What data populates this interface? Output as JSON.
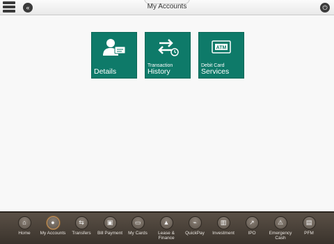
{
  "header": {
    "title": "My Accounts",
    "back_icon": "«",
    "power_icon": "⏻"
  },
  "tiles": [
    {
      "small": "",
      "big": "Details",
      "icon": "user-card-icon"
    },
    {
      "small": "Transaction",
      "big": "History",
      "icon": "transfer-clock-icon"
    },
    {
      "small": "Debit Card",
      "big": "Services",
      "icon": "atm-card-icon",
      "icon_text": "ATM"
    }
  ],
  "nav": [
    {
      "label": "Home",
      "glyph": "⌂"
    },
    {
      "label": "My Accounts",
      "glyph": "●"
    },
    {
      "label": "Transfers",
      "glyph": "⇆"
    },
    {
      "label": "Bill Payment",
      "glyph": "▣"
    },
    {
      "label": "My Cards",
      "glyph": "▭"
    },
    {
      "label": "Lease &\nFinance",
      "glyph": "▲"
    },
    {
      "label": "QuickPay",
      "glyph": "⌁"
    },
    {
      "label": "Investment",
      "glyph": "▥"
    },
    {
      "label": "IPO",
      "glyph": "↗"
    },
    {
      "label": "Emergency\nCash",
      "glyph": "⚠"
    },
    {
      "label": "PFM",
      "glyph": "▤"
    }
  ],
  "colors": {
    "tile": "#0e7a69",
    "nav_bar": "#4a4239",
    "active_ring": "#c8955a"
  }
}
